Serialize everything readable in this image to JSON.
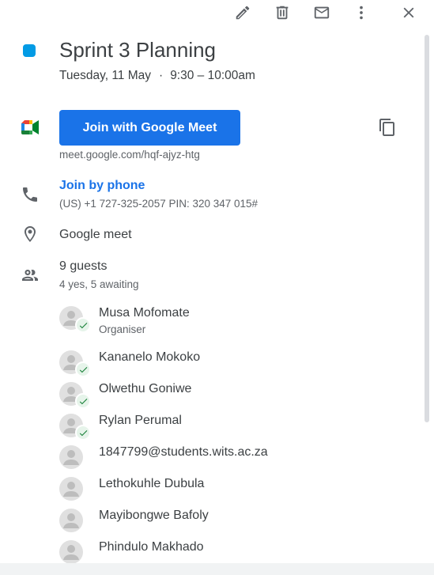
{
  "toolbar": {
    "edit_icon": "pencil-icon",
    "delete_icon": "trash-icon",
    "email_icon": "mail-icon",
    "more_icon": "more-vert-icon",
    "close_icon": "close-icon"
  },
  "event": {
    "color": "#039be5",
    "title": "Sprint 3 Planning",
    "date": "Tuesday, 11 May",
    "separator": "·",
    "time": "9:30 – 10:00am"
  },
  "meet": {
    "join_label": "Join with Google Meet",
    "link": "meet.google.com/hqf-ajyz-htg",
    "button_color": "#1a73e8"
  },
  "phone": {
    "label": "Join by phone",
    "detail": "(US) +1 727-325-2057 PIN: 320 347 015#"
  },
  "location": "Google meet",
  "guests": {
    "count_label": "9 guests",
    "status_label": "4 yes, 5 awaiting",
    "list": [
      {
        "name": "Musa Mofomate",
        "role": "Organiser",
        "accepted": true
      },
      {
        "name": "Kananelo Mokoko",
        "role": "",
        "accepted": true
      },
      {
        "name": "Olwethu Goniwe",
        "role": "",
        "accepted": true
      },
      {
        "name": "Rylan Perumal",
        "role": "",
        "accepted": true
      },
      {
        "name": "1847799@students.wits.ac.za",
        "role": "",
        "accepted": false
      },
      {
        "name": "Lethokuhle Dubula",
        "role": "",
        "accepted": false
      },
      {
        "name": "Mayibongwe Bafoly",
        "role": "",
        "accepted": false
      },
      {
        "name": "Phindulo Makhado",
        "role": "",
        "accepted": false
      }
    ]
  }
}
